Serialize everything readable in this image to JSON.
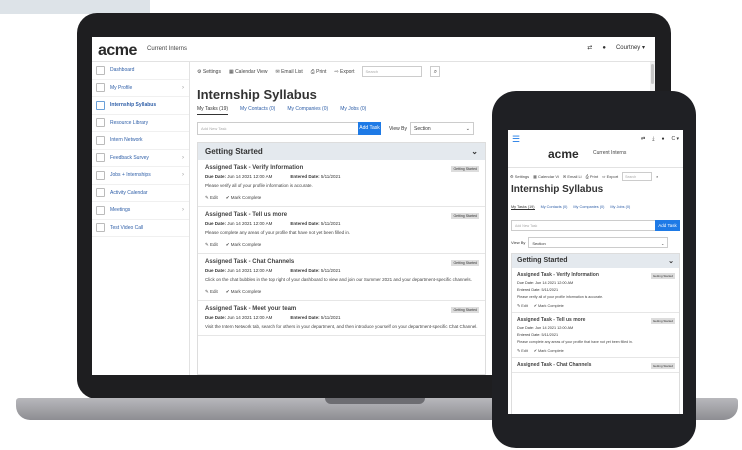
{
  "app": {
    "logo": "acme",
    "brand_sub": "Current Interns",
    "user": "Courtney"
  },
  "sidebar": {
    "items": [
      {
        "label": "Dashboard",
        "icon": "grid-icon",
        "chevron": ""
      },
      {
        "label": "My Profile",
        "icon": "user-icon",
        "chevron": "›"
      },
      {
        "label": "Internship Syllabus",
        "icon": "people-icon",
        "chevron": "",
        "active": true
      },
      {
        "label": "Resource Library",
        "icon": "book-icon",
        "chevron": ""
      },
      {
        "label": "Intern Network",
        "icon": "network-icon",
        "chevron": ""
      },
      {
        "label": "Feedback Survey",
        "icon": "survey-icon",
        "chevron": "›"
      },
      {
        "label": "Jobs + Internships",
        "icon": "briefcase-icon",
        "chevron": "›"
      },
      {
        "label": "Activity Calendar",
        "icon": "calendar-icon",
        "chevron": ""
      },
      {
        "label": "Meetings",
        "icon": "meeting-icon",
        "chevron": "›"
      },
      {
        "label": "Test Video Call",
        "icon": "video-icon",
        "chevron": ""
      }
    ]
  },
  "toolbar": {
    "settings": "⚙ Settings",
    "calendar": "▦ Calendar View",
    "email": "✉ Email List",
    "print": "⎙ Print",
    "export": "⇨ Export",
    "search_placeholder": "Search",
    "search_btn": "⌕"
  },
  "page": {
    "title": "Internship Syllabus",
    "tabs": [
      "My Tasks (19)",
      "My Contacts (0)",
      "My Companies (0)",
      "My Jobs (0)"
    ],
    "add_placeholder": "Add New Task",
    "add_btn": "Add Task",
    "view_by_label": "View By",
    "view_by_value": "Section",
    "section_title": "Getting Started",
    "section_chevron": "⌄"
  },
  "tasks": [
    {
      "title": "Assigned Task - Verify Information",
      "badge": "Getting Started",
      "due_label": "Due Date:",
      "due": "Jun 14 2021 12:00 AM",
      "entered_label": "Entered Date:",
      "entered": "5/11/2021",
      "desc": "Please verify all of your profile information is accurate.",
      "edit": "✎ Edit",
      "complete": "✔ Mark Complete"
    },
    {
      "title": "Assigned Task - Tell us more",
      "badge": "Getting Started",
      "due_label": "Due Date:",
      "due": "Jun 14 2021 12:00 AM",
      "entered_label": "Entered Date:",
      "entered": "5/11/2021",
      "desc": "Please complete any areas of your profile that have not yet been filled in.",
      "edit": "✎ Edit",
      "complete": "✔ Mark Complete"
    },
    {
      "title": "Assigned Task - Chat Channels",
      "badge": "Getting Started",
      "due_label": "Due Date:",
      "due": "Jun 14 2021 12:00 AM",
      "entered_label": "Entered Date:",
      "entered": "5/11/2021",
      "desc": "Click on the chat bubbles in the top right of your dashboard to view and join our Summer 2021 and your department-specific channels.",
      "edit": "✎ Edit",
      "complete": "✔ Mark Complete"
    },
    {
      "title": "Assigned Task - Meet your team",
      "badge": "Getting Started",
      "due_label": "Due Date:",
      "due": "Jun 14 2021 12:00 AM",
      "entered_label": "Entered Date:",
      "entered": "5/11/2021",
      "desc": "Visit the Intern Network tab, search for others in your department, and then introduce yourself on your department-specific Chat Channel.",
      "edit": "",
      "complete": ""
    }
  ],
  "phone": {
    "menu": "☰",
    "user": "C ▾",
    "toolbar": [
      "⚙ Settings",
      "▦ Calendar Vi",
      "✉ Email Li",
      "⎙ Print",
      "⇨ Export"
    ],
    "search_placeholder": "Search",
    "tabs": [
      "My Tasks (19)",
      "My Contacts (0)",
      "My Companies (0)",
      "My Jobs (0)"
    ],
    "add_placeholder": "Add New Task",
    "add_btn": "Add Task",
    "view_by_label": "View By",
    "view_by_value": "Section",
    "tasks": [
      {
        "title": "Assigned Task - Verify Information",
        "badge": "Getting Started",
        "due": "Due Date: Jun 14 2021 12:00 AM",
        "entered": "Entered Date: 5/11/2021",
        "desc": "Please verify all of your profile information is accurate.",
        "edit": "✎ Edit",
        "complete": "✔ Mark Complete"
      },
      {
        "title": "Assigned Task - Tell us more",
        "badge": "Getting Started",
        "due": "Due Date: Jun 14 2021 12:00 AM",
        "entered": "Entered Date: 5/11/2021",
        "desc": "Please complete any areas of your profile that have not yet been filled in.",
        "edit": "✎ Edit",
        "complete": "✔ Mark Complete"
      },
      {
        "title": "Assigned Task - Chat Channels",
        "badge": "Getting Started",
        "due": "",
        "entered": "",
        "desc": "",
        "edit": "",
        "complete": ""
      }
    ]
  },
  "colors": {
    "accent": "#1e7ae6",
    "section_bg": "#e4e9ee",
    "device": "#1e1e20"
  }
}
